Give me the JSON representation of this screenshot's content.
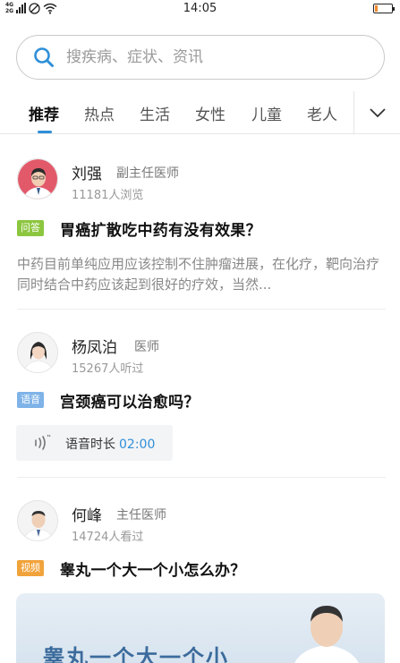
{
  "status_bar": {
    "network_top": "4G",
    "network_bottom": "2G",
    "time": "14:05"
  },
  "search": {
    "placeholder": "搜疾病、症状、资讯"
  },
  "tabs": [
    {
      "label": "推荐"
    },
    {
      "label": "热点"
    },
    {
      "label": "生活"
    },
    {
      "label": "女性"
    },
    {
      "label": "儿童"
    },
    {
      "label": "老人"
    }
  ],
  "feed": [
    {
      "doctor": "刘强",
      "title": "副主任医师",
      "meta": "11181人浏览",
      "tag": "问答",
      "tag_color": "#8cc63f",
      "question": "胃癌扩散吃中药有没有效果？",
      "excerpt": "中药目前单纯应用应该控制不住肿瘤进展，在化疗，靶向治疗同时结合中药应该起到很好的疗效，当然..."
    },
    {
      "doctor": "杨凤泊",
      "title": "医师",
      "meta": "15267人听过",
      "tag": "语音",
      "tag_color": "#7fb3e8",
      "question": "宫颈癌可以治愈吗？",
      "voice_label": "语音时长",
      "voice_duration": "02:00"
    },
    {
      "doctor": "何峰",
      "title": "主任医师",
      "meta": "14724人看过",
      "tag": "视频",
      "tag_color": "#f1a33b",
      "question": "睾丸一个大一个小怎么办？",
      "video_caption": "睾丸一个大一个小"
    }
  ]
}
